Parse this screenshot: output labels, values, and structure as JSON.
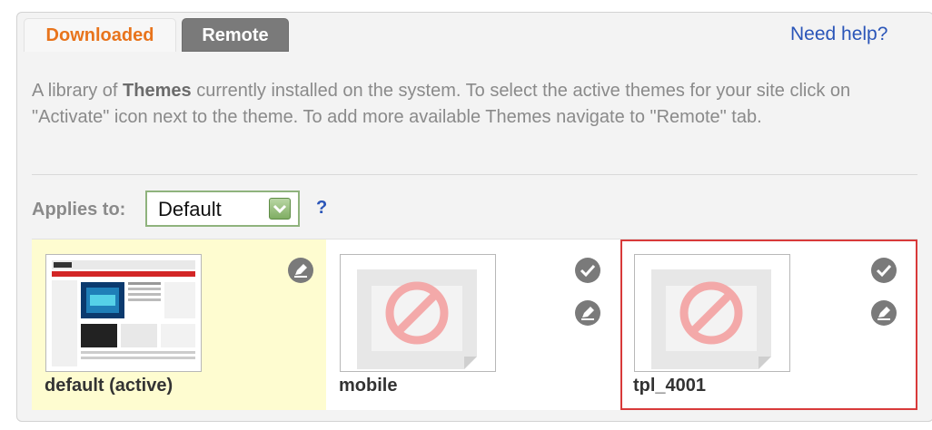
{
  "tabs": [
    {
      "label": "Downloaded",
      "active": true
    },
    {
      "label": "Remote",
      "active": false
    }
  ],
  "help_link": "Need help?",
  "description": {
    "before": "A library of ",
    "bold": "Themes",
    "after": " currently installed on the system. To select the active themes for your site click on \"Activate\" icon next to the theme. To add more available Themes navigate to \"Remote\" tab."
  },
  "applies": {
    "label": "Applies to:",
    "selected": "Default",
    "help": "?"
  },
  "themes": [
    {
      "name": "default (active)",
      "active": true,
      "thumbnail": "site-preview",
      "actions": [
        "edit-icon"
      ]
    },
    {
      "name": "mobile",
      "active": false,
      "thumbnail": "no-preview",
      "actions": [
        "activate-icon",
        "edit-icon"
      ]
    },
    {
      "name": "tpl_4001",
      "active": false,
      "selected": true,
      "thumbnail": "no-preview",
      "actions": [
        "activate-icon",
        "edit-icon"
      ]
    }
  ],
  "colors": {
    "active_tab_text": "#e8741c",
    "inactive_tab_bg": "#7a7a7a",
    "link": "#2a55b8",
    "active_card_bg": "#fefcd0",
    "selection_border": "#d83a3a"
  }
}
